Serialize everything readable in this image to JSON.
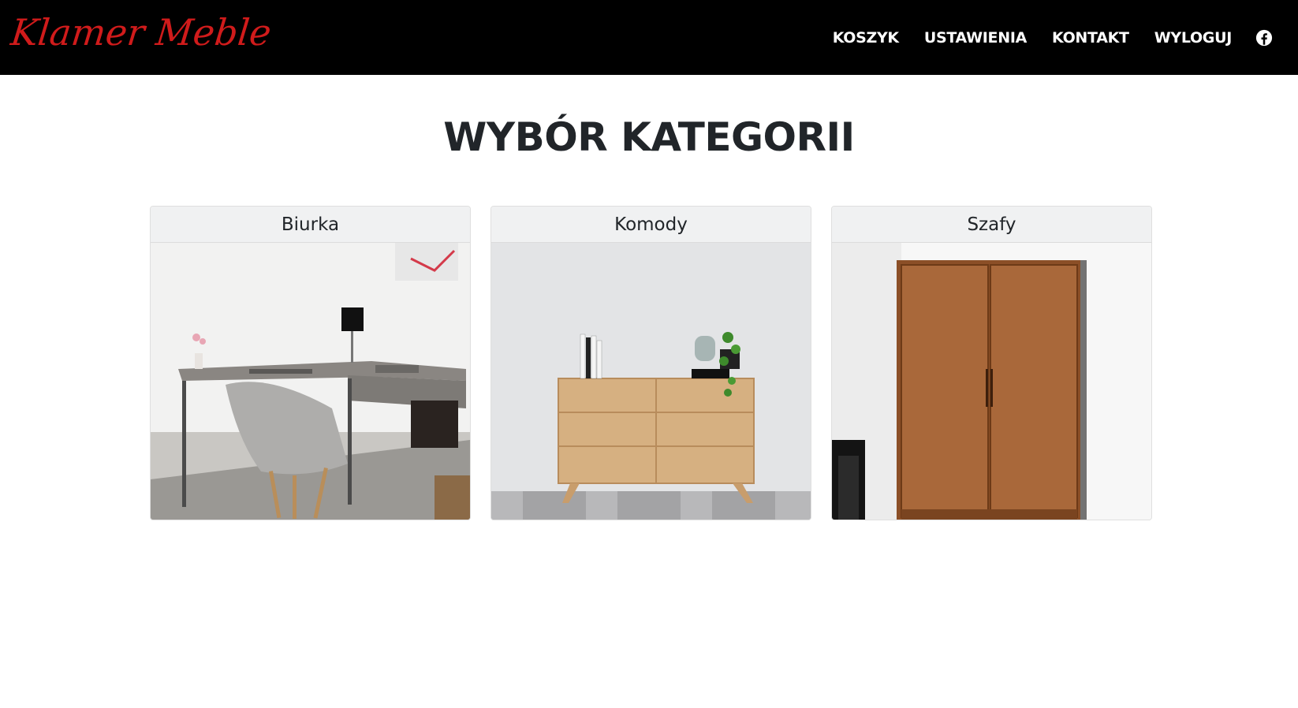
{
  "navbar": {
    "brand": "Klamer Meble",
    "links": [
      "KOSZYK",
      "USTAWIENIA",
      "KONTAKT",
      "WYLOGUJ"
    ],
    "social_icon": "facebook-icon"
  },
  "page": {
    "title": "WYBÓR KATEGORII"
  },
  "categories": [
    {
      "name": "Biurka",
      "image": "desk-office-photo"
    },
    {
      "name": "Komody",
      "image": "dresser-photo"
    },
    {
      "name": "Szafy",
      "image": "wardrobe-photo"
    }
  ],
  "colors": {
    "navbar_bg": "#000000",
    "brand": "#d01b1b",
    "nav_text": "#ffffff",
    "card_header_bg": "#f0f1f2"
  }
}
